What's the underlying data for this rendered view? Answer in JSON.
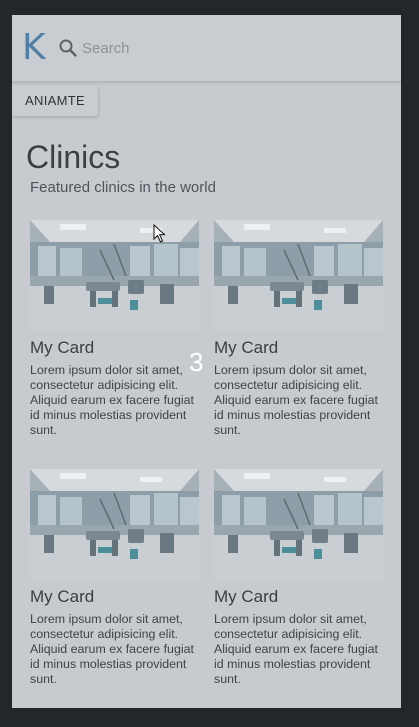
{
  "header": {
    "logo": "K",
    "search_placeholder": "Search"
  },
  "toolbar": {
    "animate_label": "ANIAMTE"
  },
  "main": {
    "title": "Clinics",
    "subtitle": "Featured clinics in the world",
    "cards": [
      {
        "title": "My Card",
        "text": "Lorem ipsum dolor sit amet, consectetur adipisicing elit. Aliquid earum ex facere fugiat id minus molestias provident sunt."
      },
      {
        "title": "My Card",
        "text": "Lorem ipsum dolor sit amet, consectetur adipisicing elit. Aliquid earum ex facere fugiat id minus molestias provident sunt."
      },
      {
        "title": "My Card",
        "text": "Lorem ipsum dolor sit amet, consectetur adipisicing elit. Aliquid earum ex facere fugiat id minus molestias provident sunt."
      },
      {
        "title": "My Card",
        "text": "Lorem ipsum dolor sit amet, consectetur adipisicing elit. Aliquid earum ex facere fugiat id minus molestias provident sunt."
      }
    ]
  },
  "overlay": {
    "page_number": "3"
  },
  "colors": {
    "background": "#23272c",
    "surface": "#c7cbcf",
    "logo": "#4f7fa6"
  },
  "icons": {
    "search": "search-icon",
    "cursor": "mouse-cursor-icon"
  }
}
